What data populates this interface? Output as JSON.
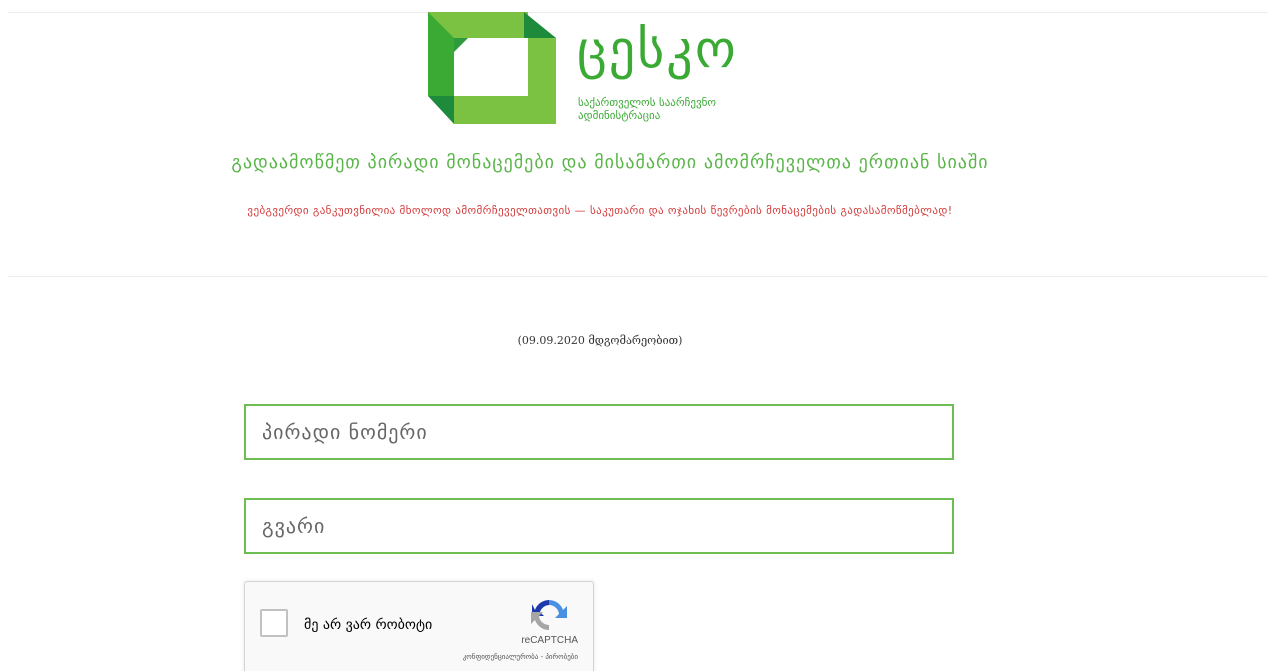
{
  "header": {
    "logo": {
      "wordmark": "ცესკო",
      "subtitle_line1": "საქართველოს საარჩევნო",
      "subtitle_line2": "ადმინისტრაცია",
      "colors": {
        "primary": "#3aaa35",
        "light": "#7cc242",
        "dark": "#1e8a3b"
      }
    },
    "headline": "გადაამოწმეთ პირადი მონაცემები და მისამართი ამომრჩეველთა ერთიან სიაში",
    "warning": "ვებგვერდი განკუთვნილია მხოლოდ ამომრჩეველთათვის — საკუთარი და ოჯახის წევრების მონაცემების გადასამოწმებლად!"
  },
  "status": {
    "as_of": "(09.09.2020 მდგომარეობით)"
  },
  "form": {
    "personal_id": {
      "placeholder": "პირადი ნომერი",
      "value": ""
    },
    "surname": {
      "placeholder": "გვარი",
      "value": ""
    }
  },
  "recaptcha": {
    "label": "მე არ ვარ რობოტი",
    "brand": "reCAPTCHA",
    "links": "კონფიდენციალურობა - პირობები",
    "icon": "recaptcha-logo-icon"
  },
  "colors": {
    "accent_green": "#59b548",
    "field_border": "#6cbe51",
    "warning_red": "#d43b3b"
  }
}
